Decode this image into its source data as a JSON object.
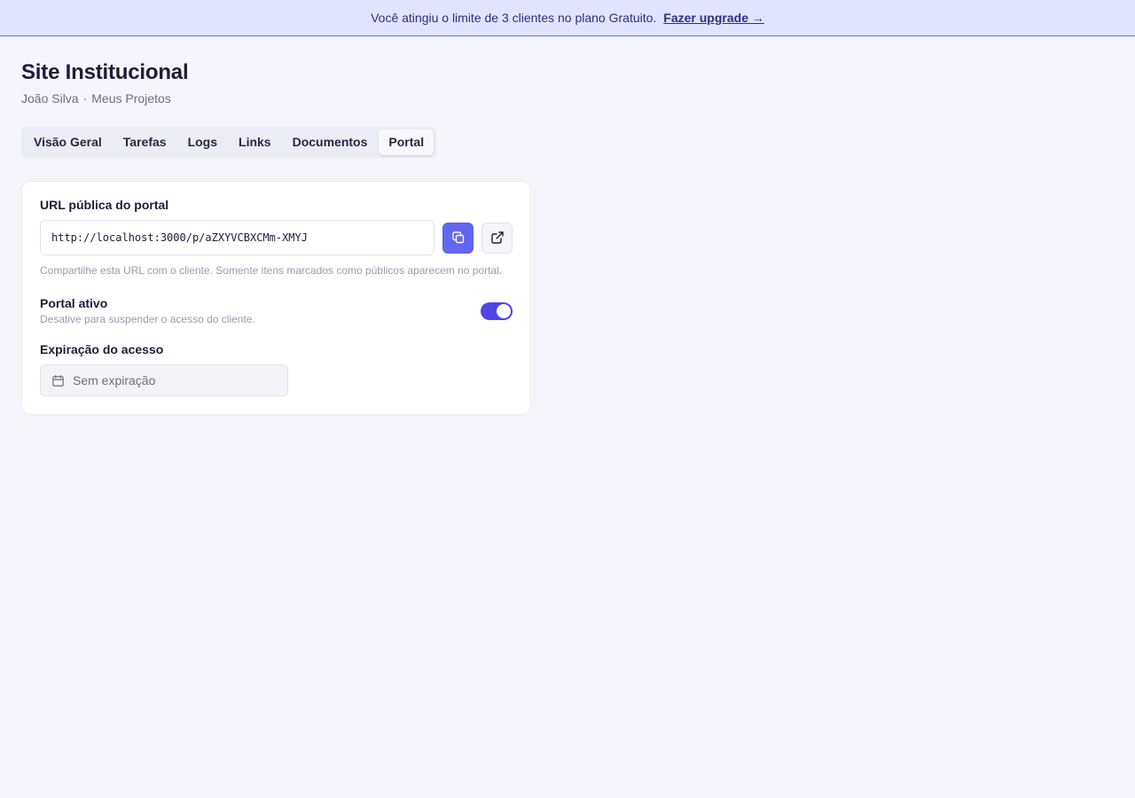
{
  "banner": {
    "message": "Você atingiu o limite de 3 clientes no plano Gratuito.",
    "link_label": "Fazer upgrade →"
  },
  "header": {
    "title": "Site Institucional",
    "breadcrumb": {
      "client": "João Silva",
      "separator": "·",
      "section": "Meus Projetos"
    }
  },
  "tabs": [
    {
      "label": "Visão Geral",
      "active": false
    },
    {
      "label": "Tarefas",
      "active": false
    },
    {
      "label": "Logs",
      "active": false
    },
    {
      "label": "Links",
      "active": false
    },
    {
      "label": "Documentos",
      "active": false
    },
    {
      "label": "Portal",
      "active": true
    }
  ],
  "portal": {
    "url_label": "URL pública do portal",
    "url_value": "http://localhost:3000/p/aZXYVCBXCMm-XMYJ",
    "copy_icon": "copy-icon",
    "open_icon": "external-link-icon",
    "help_text": "Compartilhe esta URL com o cliente. Somente itens marcados como públicos aparecem no portal.",
    "active_label": "Portal ativo",
    "active_description": "Desative para suspender o acesso do cliente.",
    "active": true,
    "expiry_label": "Expiração do acesso",
    "expiry_value": "Sem expiração",
    "expiry_icon": "calendar-icon"
  },
  "colors": {
    "accent": "#6366f1",
    "toggle_on": "#4f46e5",
    "banner_bg": "#e1e4fd",
    "banner_text": "#312e81",
    "page_bg": "#f6f5fc"
  }
}
